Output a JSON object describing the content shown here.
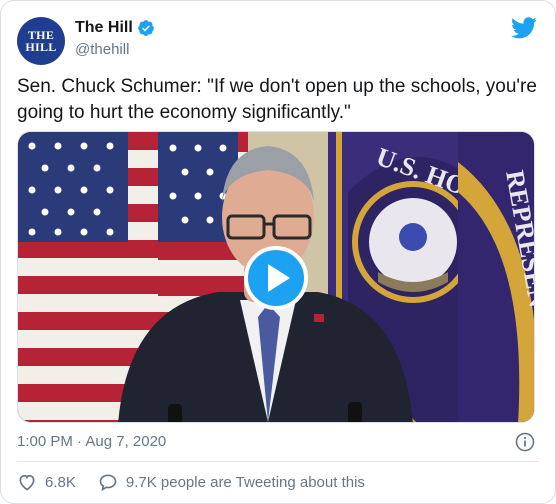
{
  "author": {
    "display_name": "The Hill",
    "handle": "@thehill",
    "avatar_text_top": "THE",
    "avatar_text_bottom": "HILL"
  },
  "tweet": {
    "text": "Sen. Chuck Schumer: \"If we don't open up the schools, you're going to hurt the economy significantly.\"",
    "timestamp": "1:00 PM · Aug 7, 2020"
  },
  "stats": {
    "likes": "6.8K",
    "retweet_summary": "9.7K people are Tweeting about this"
  },
  "video": {
    "seal_text_upper": "U.S. HO",
    "seal_text_side": "REPRESEN"
  },
  "colors": {
    "twitter_blue": "#1da1f2",
    "text_primary": "#14171a",
    "text_secondary": "#657786",
    "avatar_bg": "#1f3e8f",
    "seal_purple": "#3b2d7a",
    "seal_gold": "#d4a63a"
  },
  "icons": {
    "brand": "twitter-bird-icon",
    "verified": "verified-badge-icon",
    "play": "play-icon",
    "info": "info-icon",
    "like": "heart-icon",
    "comment": "speech-bubble-icon"
  }
}
